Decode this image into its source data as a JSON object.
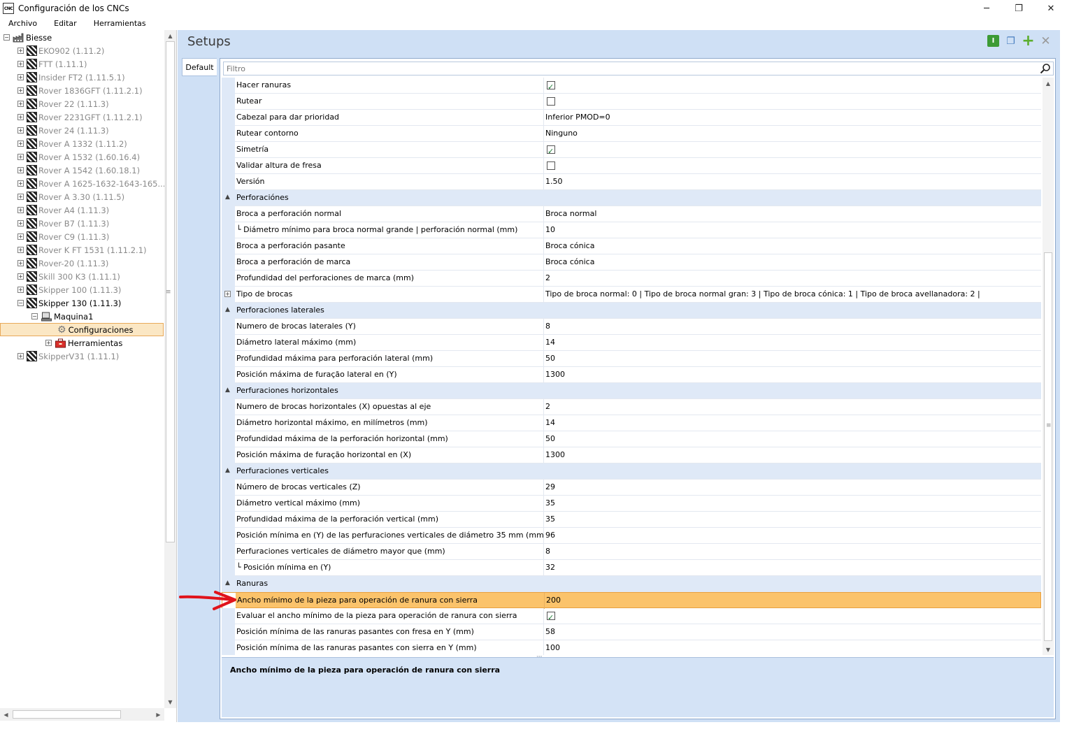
{
  "window": {
    "app_icon_text": "CNC",
    "title": "Configuración de los CNCs"
  },
  "menu": [
    "Archivo",
    "Editar",
    "Herramientas"
  ],
  "tree": {
    "root": "Biesse",
    "items": [
      "EKO902 (1.11.2)",
      "FTT (1.11.1)",
      "Insider FT2 (1.11.5.1)",
      "Rover 1836GFT (1.11.2.1)",
      "Rover 22 (1.11.3)",
      "Rover 2231GFT (1.11.2.1)",
      "Rover 24 (1.11.3)",
      "Rover A 1332 (1.11.2)",
      "Rover A 1532 (1.60.16.4)",
      "Rover A 1542 (1.60.18.1)",
      "Rover A 1625-1632-1643-165...",
      "Rover A 3.30 (1.11.5)",
      "Rover A4 (1.11.3)",
      "Rover B7 (1.11.3)",
      "Rover C9 (1.11.3)",
      "Rover K FT 1531 (1.11.2.1)",
      "Rover-20 (1.11.3)",
      "Skill 300 K3 (1.11.1)",
      "Skipper 100 (1.11.3)"
    ],
    "expanded_item": "Skipper 130 (1.11.3)",
    "machine": "Maquina1",
    "config": "Configuraciones",
    "tools": "Herramientas",
    "last_item": "SkipperV31 (1.11.1)"
  },
  "panel": {
    "title": "Setups",
    "tab": "Default",
    "filter_placeholder": "Filtro"
  },
  "grid": {
    "rows": [
      {
        "type": "prop",
        "name": "Hacer ranuras",
        "check": true
      },
      {
        "type": "prop",
        "name": "Rutear",
        "check": false
      },
      {
        "type": "prop",
        "name": "Cabezal para dar prioridad",
        "value": "Inferior PMOD=0"
      },
      {
        "type": "prop",
        "name": "Rutear contorno",
        "value": "Ninguno"
      },
      {
        "type": "prop",
        "name": "Simetría",
        "check": true
      },
      {
        "type": "prop",
        "name": "Validar altura de fresa",
        "check": false
      },
      {
        "type": "prop",
        "name": "Versión",
        "value": "1.50"
      },
      {
        "type": "cat",
        "name": "Perforaciónes"
      },
      {
        "type": "prop",
        "name": "Broca a perforación normal",
        "value": "Broca normal"
      },
      {
        "type": "prop",
        "name": "└ Diámetro mínimo para broca normal grande | perforación normal (mm)",
        "value": "10"
      },
      {
        "type": "prop",
        "name": "Broca a perforación pasante",
        "value": "Broca cónica"
      },
      {
        "type": "prop",
        "name": "Broca a perforación de marca",
        "value": "Broca cónica"
      },
      {
        "type": "prop",
        "name": "Profundidad del perforaciones de marca (mm)",
        "value": "2"
      },
      {
        "type": "prop",
        "name": "Tipo de brocas",
        "value": "Tipo de broca normal: 0  |  Tipo de broca normal gran: 3  |  Tipo de broca cónica: 1  |  Tipo de broca avellanadora: 2  |",
        "expander": true
      },
      {
        "type": "cat",
        "name": "Perforaciones laterales"
      },
      {
        "type": "prop",
        "name": "Numero de brocas laterales (Y)",
        "value": "8"
      },
      {
        "type": "prop",
        "name": "Diámetro lateral máximo (mm)",
        "value": "14"
      },
      {
        "type": "prop",
        "name": "Profundidad máxima para perforación lateral (mm)",
        "value": "50"
      },
      {
        "type": "prop",
        "name": "Posición máxima de furação lateral en (Y)",
        "value": "1300"
      },
      {
        "type": "cat",
        "name": "Perfuraciones horizontales"
      },
      {
        "type": "prop",
        "name": "Numero de brocas horizontales (X) opuestas al eje",
        "value": "2"
      },
      {
        "type": "prop",
        "name": "Diámetro horizontal máximo, en milímetros (mm)",
        "value": "14"
      },
      {
        "type": "prop",
        "name": "Profundidad máxima de la perforación horizontal (mm)",
        "value": "50"
      },
      {
        "type": "prop",
        "name": "Posición máxima de furação horizontal en (X)",
        "value": "1300"
      },
      {
        "type": "cat",
        "name": "Perfuraciones verticales"
      },
      {
        "type": "prop",
        "name": "Número de brocas verticales (Z)",
        "value": "29"
      },
      {
        "type": "prop",
        "name": "Diámetro vertical máximo (mm)",
        "value": "35"
      },
      {
        "type": "prop",
        "name": "Profundidad máxima de la perforación vertical (mm)",
        "value": "35"
      },
      {
        "type": "prop",
        "name": "Posición mínima en (Y) de las perfuraciones verticales de diámetro 35 mm (mm)",
        "value": "96"
      },
      {
        "type": "prop",
        "name": "Perfuraciones verticales de diámetro mayor que (mm)",
        "value": "8"
      },
      {
        "type": "prop",
        "name": "└ Posición mínima en (Y)",
        "value": "32"
      },
      {
        "type": "cat",
        "name": "Ranuras"
      },
      {
        "type": "prop",
        "name": "Ancho mínimo de la pieza para operación de ranura con sierra",
        "value": "200",
        "selected": true
      },
      {
        "type": "prop",
        "name": "Evaluar el ancho mínimo de la pieza para operación de ranura con sierra",
        "check": true
      },
      {
        "type": "prop",
        "name": "Posición mínima de las ranuras pasantes con fresa en Y (mm)",
        "value": "58"
      },
      {
        "type": "prop",
        "name": "Posición mínima de las ranuras pasantes con sierra en Y (mm)",
        "value": "100"
      }
    ]
  },
  "description": "Ancho mínimo de la pieza para operación de ranura con sierra",
  "colors": {
    "selected_row": "#fbc36b",
    "category_bg": "#dfe9f7",
    "panel_bg": "#cfe0f5",
    "arrow": "#e0131b"
  }
}
